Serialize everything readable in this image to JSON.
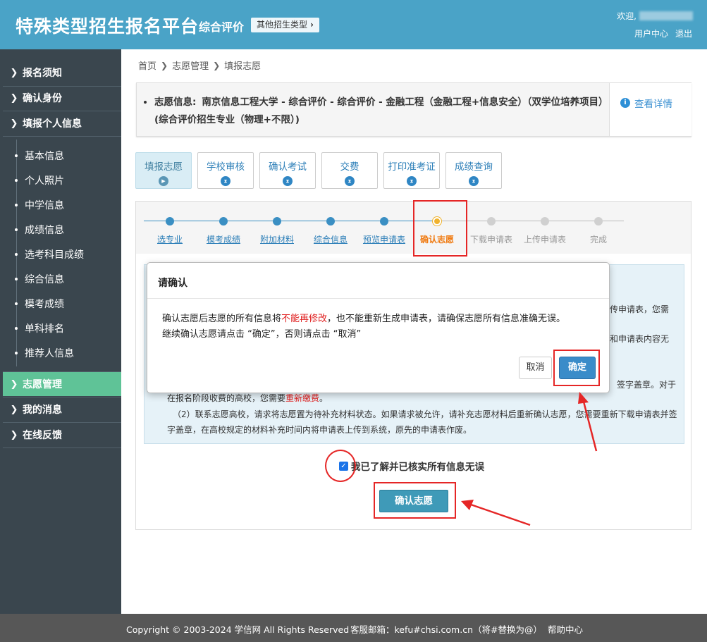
{
  "header": {
    "brand": "特殊类型招生报名平台",
    "sub_brand": "综合评价",
    "type_button": "其他招生类型",
    "welcome": "欢迎,",
    "user_center": "用户中心",
    "logout": "退出"
  },
  "sidebar": {
    "items": [
      {
        "label": "报名须知"
      },
      {
        "label": "确认身份"
      },
      {
        "label": "填报个人信息"
      }
    ],
    "sub_items": [
      {
        "label": "基本信息"
      },
      {
        "label": "个人照片"
      },
      {
        "label": "中学信息"
      },
      {
        "label": "成绩信息"
      },
      {
        "label": "选考科目成绩"
      },
      {
        "label": "综合信息"
      },
      {
        "label": "模考成绩"
      },
      {
        "label": "单科排名"
      },
      {
        "label": "推荐人信息"
      }
    ],
    "bottom_items": [
      {
        "label": "志愿管理",
        "active": true
      },
      {
        "label": "我的消息"
      },
      {
        "label": "在线反馈"
      }
    ]
  },
  "breadcrumb": [
    "首页",
    "志愿管理",
    "填报志愿"
  ],
  "info": {
    "label": "志愿信息:",
    "text": "南京信息工程大学 - 综合评价 - 综合评价 - 金融工程（金融工程+信息安全）（双学位培养项目）(综合评价招生专业（物理+不限）)",
    "detail_link": "查看详情"
  },
  "step_tabs": [
    {
      "label": "填报志愿",
      "active": true
    },
    {
      "label": "学校审核"
    },
    {
      "label": "确认考试"
    },
    {
      "label": "交费"
    },
    {
      "label": "打印准考证"
    },
    {
      "label": "成绩查询"
    }
  ],
  "progress": [
    {
      "label": "选专业",
      "state": "done"
    },
    {
      "label": "模考成绩",
      "state": "done"
    },
    {
      "label": "附加材料",
      "state": "done"
    },
    {
      "label": "综合信息",
      "state": "done"
    },
    {
      "label": "预览申请表",
      "state": "done"
    },
    {
      "label": "确认志愿",
      "state": "current"
    },
    {
      "label": "下载申请表",
      "state": "todo"
    },
    {
      "label": "上传申请表",
      "state": "todo"
    },
    {
      "label": "完成",
      "state": "todo"
    }
  ],
  "notice": {
    "frag_r1": "传申请表，您需",
    "frag_r2": "和申请表内容无",
    "frag_r3": "签字盖章。对于",
    "line4_a": "在报名阶段收费的高校，您需要",
    "line4_red": "重新缴费",
    "line4_b": "。",
    "line5": "（2）联系志愿高校，请求将志愿置为待补充材料状态。如果请求被允许，请补充志愿材料后重新确认志愿，您需要重新下载申请表并签",
    "line6": "字盖章，在高校规定的材料补充时间内将申请表上传到系统，原先的申请表作废。"
  },
  "agree_text": "我已了解并已核实所有信息无误",
  "agree_checked": true,
  "confirm_button": "确认志愿",
  "modal": {
    "title": "请确认",
    "body_a": "确认志愿后志愿的所有信息将",
    "body_red": "不能再修改",
    "body_b": "，也不能重新生成申请表，请确保志愿所有信息准确无误。",
    "body_line2": "继续确认志愿请点击 “确定”，否则请点击 “取消”",
    "cancel": "取消",
    "ok": "确定"
  },
  "footer": {
    "copyright": "Copyright © 2003-2024 学信网 All Rights Reserved",
    "email": "客服邮箱：kefu#chsi.com.cn（将#替换为@）",
    "help": "帮助中心"
  },
  "colors": {
    "header": "#4aa3c7",
    "sidebar": "#3a464e",
    "sidebar_active": "#5fc397",
    "annotation": "#e52626",
    "current_step": "#f0b22d"
  }
}
